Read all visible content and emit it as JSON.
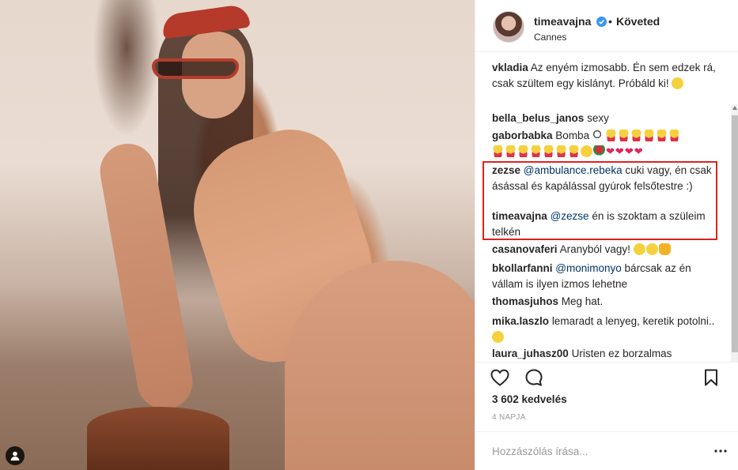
{
  "post": {
    "username": "timeavajna",
    "separator": "•",
    "follow_status": "Követed",
    "location": "Cannes"
  },
  "comments": [
    {
      "user": "vkladia",
      "user_display": "vkladia",
      "text": "Az enyém izmosabb. Én sem edzek rá, csak szültem egy kislányt. Próbáld ki!"
    },
    {
      "user": "bella_belus_janos",
      "text": "sexy"
    },
    {
      "user": "gaborbabka",
      "text": "Bomba"
    },
    {
      "user": "zezse",
      "mention": "@ambulance.rebeka",
      "text": "cuki vagy, én csak ásással és kapálással gyúrok felsőtestre :)"
    },
    {
      "user": "timeavajna",
      "mention": "@zezse",
      "text": "én is szoktam a szüleim telkén"
    },
    {
      "user": "casanovaferi",
      "text": "Aranyból vagy!"
    },
    {
      "user": "bkollarfanni",
      "mention": "@monimonyo",
      "text": "bárcsak az én vállam is ilyen izmos lehetne"
    },
    {
      "user": "thomasjuhos",
      "text": "Meg hat."
    },
    {
      "user": "mika.laszlo",
      "text": "lemaradt a lenyeg, keretik potolni.."
    },
    {
      "user": "laura_juhasz00",
      "text": "Uristen ez borzalmas"
    }
  ],
  "likes": "3 602 kedvelés",
  "date": "4 NAPJA",
  "add_comment": {
    "placeholder": "Hozzászólás írása..."
  },
  "icons": {
    "like": "heart-outline-icon",
    "comment": "speech-bubble-icon",
    "save": "bookmark-icon",
    "more": "ellipsis-icon",
    "verified": "verified-badge-icon",
    "tag": "user-tag-icon"
  },
  "colors": {
    "text": "#262626",
    "mention": "#003569",
    "muted": "#999999",
    "verified": "#3897f0",
    "highlight_box": "#e02020"
  }
}
